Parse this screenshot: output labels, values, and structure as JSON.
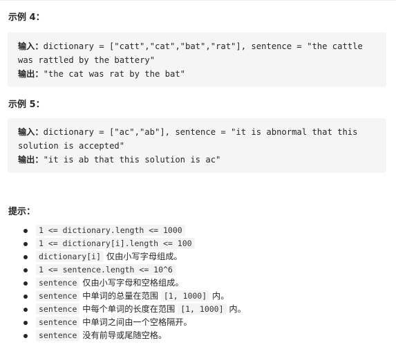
{
  "example4": {
    "title": "示例 4：",
    "input_label": "输入：",
    "input_line1": "dictionary = [\"catt\",\"cat\",\"bat\",\"rat\"], sentence = \"the cattle",
    "input_line2": "was rattled by the battery\"",
    "output_label": "输出：",
    "output_value": "\"the cat was rat by the bat\""
  },
  "example5": {
    "title": "示例 5：",
    "input_label": "输入：",
    "input_line1": "dictionary = [\"ac\",\"ab\"], sentence = \"it is abnormal that this",
    "input_line2": "solution is accepted\"",
    "output_label": "输出：",
    "output_value": "\"it is ab that this solution is ac\""
  },
  "hints": {
    "title": "提示：",
    "items": [
      {
        "code": "1 <= dictionary.length  <= 1000",
        "text": ""
      },
      {
        "code": "1 <= dictionary[i].length <= 100",
        "text": ""
      },
      {
        "code": "dictionary[i]",
        "text": " 仅由小写字母组成。"
      },
      {
        "code": "1 <= sentence.length <= 10^6",
        "text": ""
      },
      {
        "code": "sentence",
        "text": " 仅由小写字母和空格组成。"
      },
      {
        "code": "sentence",
        "text": " 中单词的总量在范围 ",
        "code2": "[1, 1000]",
        "text2": " 内。"
      },
      {
        "code": "sentence",
        "text": " 中每个单词的长度在范围 ",
        "code2": "[1, 1000]",
        "text2": " 内。"
      },
      {
        "code": "sentence",
        "text": " 中单词之间由一个空格隔开。"
      },
      {
        "code": "sentence",
        "text": " 没有前导或尾随空格。"
      }
    ]
  }
}
